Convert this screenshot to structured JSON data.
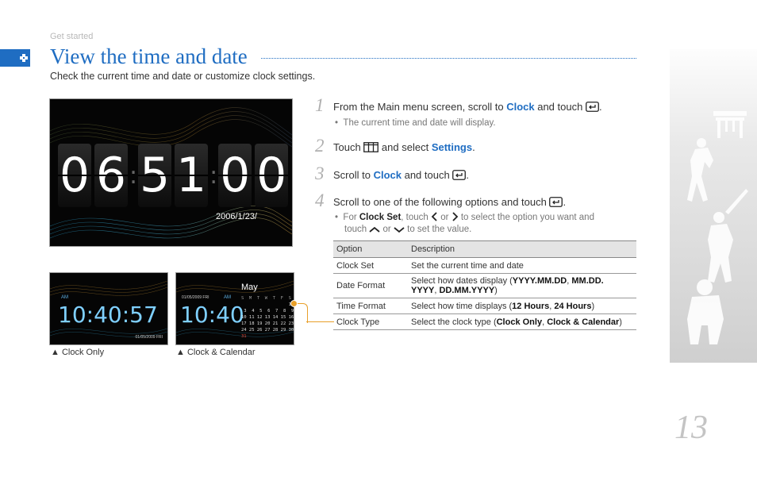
{
  "header": {
    "section_label": "Get started",
    "title": "View the time and date",
    "subtitle": "Check the current time and date or customize clock settings."
  },
  "clock_main": {
    "digits": [
      "0",
      "6",
      "5",
      "1",
      "0",
      "0"
    ],
    "separator": ":",
    "date": "2006/1/23/"
  },
  "thumb_clock_only": {
    "am": "AM",
    "time": "10:40:57",
    "date": "01/05/2009  FRI"
  },
  "thumb_clock_calendar": {
    "date": "01/05/2009  FRI",
    "am": "AM",
    "time": "10:40",
    "month": "May",
    "weekdays": "S  M  T  W  T  F  S",
    "weeks": [
      "                  1  2",
      " 3  4  5  6  7  8  9",
      "10 11 12 13 14 15 16",
      "17 18 19 20 21 22 23",
      "24 25 26 27 28 29 30",
      "31"
    ]
  },
  "captions": {
    "clock_only": "▲ Clock Only",
    "clock_calendar": "▲ Clock & Calendar"
  },
  "steps": [
    {
      "num": "1",
      "pre": "From the Main menu screen, scroll to ",
      "hl": "Clock",
      "post": " and touch ",
      "end": "."
    },
    {
      "num": "2",
      "pre": "Touch ",
      "mid": " and select ",
      "hl": "Settings",
      "end": "."
    },
    {
      "num": "3",
      "pre": "Scroll to ",
      "hl": "Clock",
      "post": " and touch ",
      "end": "."
    },
    {
      "num": "4",
      "pre": "Scroll to one of the following options and touch ",
      "end": "."
    }
  ],
  "step1_bullet": "The current time and date will display.",
  "step4_bullet": {
    "a": "For ",
    "b": "Clock Set",
    "c": ", touch ",
    "d": " or ",
    "e": " to select the option you want and",
    "f": "touch ",
    "g": " or ",
    "h": " to set the value."
  },
  "table": {
    "headers": [
      "Option",
      "Description"
    ],
    "rows": [
      {
        "option": "Clock Set",
        "desc_pre": "Set the current time and date"
      },
      {
        "option": "Date Format",
        "desc_pre": "Select how dates display (",
        "b1": "YYYY.MM.DD",
        "sep1": ", ",
        "b2": "MM.DD.",
        "b2b": "YYYY",
        "sep2": ", ",
        "b3": "DD.MM.YYYY",
        "end": ")"
      },
      {
        "option": "Time Format",
        "desc_pre": "Select how time displays (",
        "b1": "12 Hours",
        "sep1": ", ",
        "b2": "24 Hours",
        "end": ")"
      },
      {
        "option": "Clock Type",
        "desc_pre": "Select the clock type (",
        "b1": "Clock Only",
        "sep1": ", ",
        "b2": "Clock & Calendar",
        "end": ")"
      }
    ]
  },
  "page_number": "13",
  "colors": {
    "accent": "#1f6dc2",
    "connector": "#e8a02a"
  }
}
